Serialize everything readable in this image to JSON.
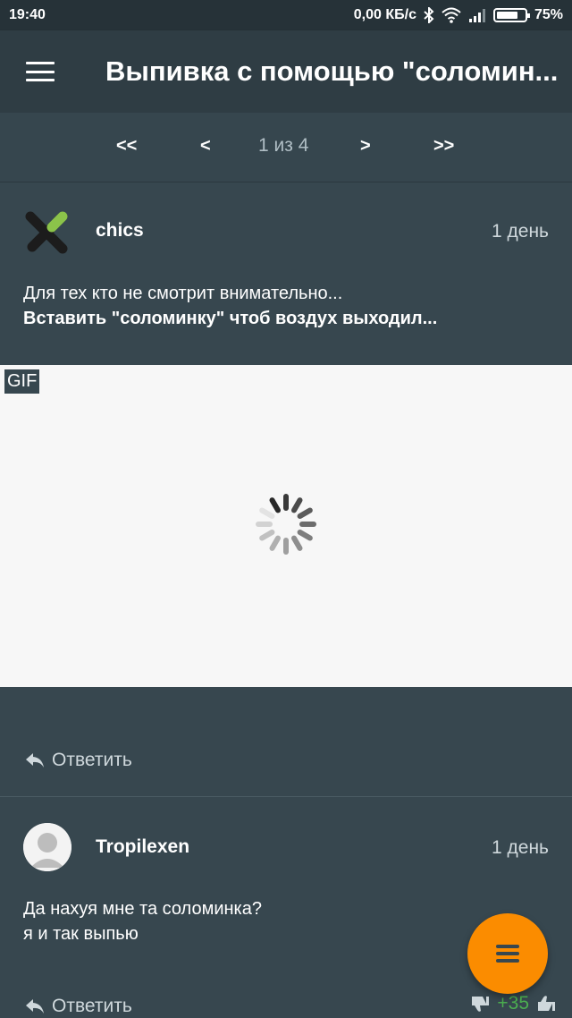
{
  "status_bar": {
    "time": "19:40",
    "network_speed": "0,00 КБ/с",
    "battery_percent": "75%",
    "battery_level": 0.75,
    "icons": [
      "bluetooth-icon",
      "wifi-icon",
      "signal-icon",
      "battery-icon"
    ]
  },
  "app_bar": {
    "title": "Выпивка с помощью \"соломин...",
    "menu_icon": "hamburger-menu-icon"
  },
  "pager": {
    "first": "<<",
    "prev": "<",
    "page_info": "1 из 4",
    "next": ">",
    "last": ">>"
  },
  "post": {
    "author": "chics",
    "age": "1 день",
    "text_line1": "Для тех кто не смотрит внимательно...",
    "text_line2": "Вставить \"соломинку\" чтоб воздух выходил...",
    "media_badge": "GIF",
    "reply_label": "Ответить"
  },
  "comment": {
    "author": "Tropilexen",
    "age": "1 день",
    "text_line1": "Да нахуя мне та соломинка?",
    "text_line2": "я и так выпью",
    "reply_label": "Ответить",
    "score": "+35"
  },
  "colors": {
    "background": "#37474f",
    "app_bar": "#2f3d44",
    "fab": "#fb8c00",
    "score": "#4caf50",
    "logo_accent": "#8bc34a"
  }
}
